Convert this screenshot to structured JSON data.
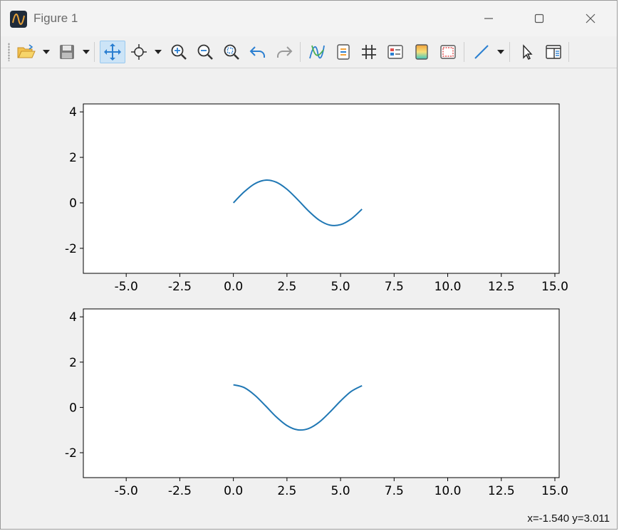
{
  "window": {
    "title": "Figure 1",
    "controls": [
      "minimize",
      "maximize",
      "close"
    ]
  },
  "toolbar": {
    "buttons": [
      {
        "id": "open",
        "icon": "folder-open-icon",
        "has_dropdown": true
      },
      {
        "id": "save",
        "icon": "floppy-disk-icon",
        "has_dropdown": true
      },
      {
        "id": "pan",
        "icon": "pan-arrows-icon",
        "active": true
      },
      {
        "id": "data-cursor",
        "icon": "data-cursor-icon",
        "has_dropdown": true
      },
      {
        "id": "zoom-in",
        "icon": "zoom-in-icon"
      },
      {
        "id": "zoom-out",
        "icon": "zoom-out-icon"
      },
      {
        "id": "zoom-fit",
        "icon": "zoom-fit-icon"
      },
      {
        "id": "undo",
        "icon": "undo-icon"
      },
      {
        "id": "redo",
        "icon": "redo-icon"
      },
      {
        "id": "curves",
        "icon": "curves-icon"
      },
      {
        "id": "legend",
        "icon": "legend-icon"
      },
      {
        "id": "grid",
        "icon": "grid-icon"
      },
      {
        "id": "properties",
        "icon": "properties-icon"
      },
      {
        "id": "colormap",
        "icon": "colormap-icon"
      },
      {
        "id": "frame",
        "icon": "frame-icon"
      },
      {
        "id": "line-tool",
        "icon": "line-tool-icon",
        "has_dropdown": true
      },
      {
        "id": "select",
        "icon": "pointer-icon"
      },
      {
        "id": "panel",
        "icon": "panel-icon"
      }
    ],
    "accent": "#2b7fd1"
  },
  "status": {
    "coords": "x=-1.540 y=3.011"
  },
  "chart_data": [
    {
      "type": "line",
      "title": "",
      "xlabel": "",
      "ylabel": "",
      "xlim": [
        -7,
        15.2
      ],
      "ylim": [
        -3.1,
        4.35
      ],
      "xticks": [
        -5.0,
        -2.5,
        0.0,
        2.5,
        5.0,
        7.5,
        10.0,
        12.5,
        15.0
      ],
      "xtick_labels": [
        "-5.0",
        "-2.5",
        "0.0",
        "2.5",
        "5.0",
        "7.5",
        "10.0",
        "12.5",
        "15.0"
      ],
      "yticks": [
        -2,
        0,
        2,
        4
      ],
      "ytick_labels": [
        "-2",
        "0",
        "2",
        "4"
      ],
      "grid": false,
      "series": [
        {
          "color": "#1f77b4",
          "x": [
            0.0,
            0.5,
            1.0,
            1.5,
            2.0,
            2.5,
            3.0,
            3.5,
            4.0,
            4.5,
            5.0,
            5.5,
            6.0
          ],
          "y": [
            0.0,
            0.479,
            0.841,
            0.997,
            0.909,
            0.598,
            0.141,
            -0.351,
            -0.757,
            -0.978,
            -0.959,
            -0.706,
            -0.279
          ]
        }
      ]
    },
    {
      "type": "line",
      "title": "",
      "xlabel": "",
      "ylabel": "",
      "xlim": [
        -7,
        15.2
      ],
      "ylim": [
        -3.1,
        4.35
      ],
      "xticks": [
        -5.0,
        -2.5,
        0.0,
        2.5,
        5.0,
        7.5,
        10.0,
        12.5,
        15.0
      ],
      "xtick_labels": [
        "-5.0",
        "-2.5",
        "0.0",
        "2.5",
        "5.0",
        "7.5",
        "10.0",
        "12.5",
        "15.0"
      ],
      "yticks": [
        -2,
        0,
        2,
        4
      ],
      "ytick_labels": [
        "-2",
        "0",
        "2",
        "4"
      ],
      "grid": false,
      "series": [
        {
          "color": "#1f77b4",
          "x": [
            0.0,
            0.5,
            1.0,
            1.5,
            2.0,
            2.5,
            3.0,
            3.5,
            4.0,
            4.5,
            5.0,
            5.5,
            6.0
          ],
          "y": [
            1.0,
            0.878,
            0.54,
            0.071,
            -0.416,
            -0.801,
            -0.99,
            -0.936,
            -0.654,
            -0.211,
            0.284,
            0.709,
            0.96
          ]
        }
      ]
    }
  ]
}
